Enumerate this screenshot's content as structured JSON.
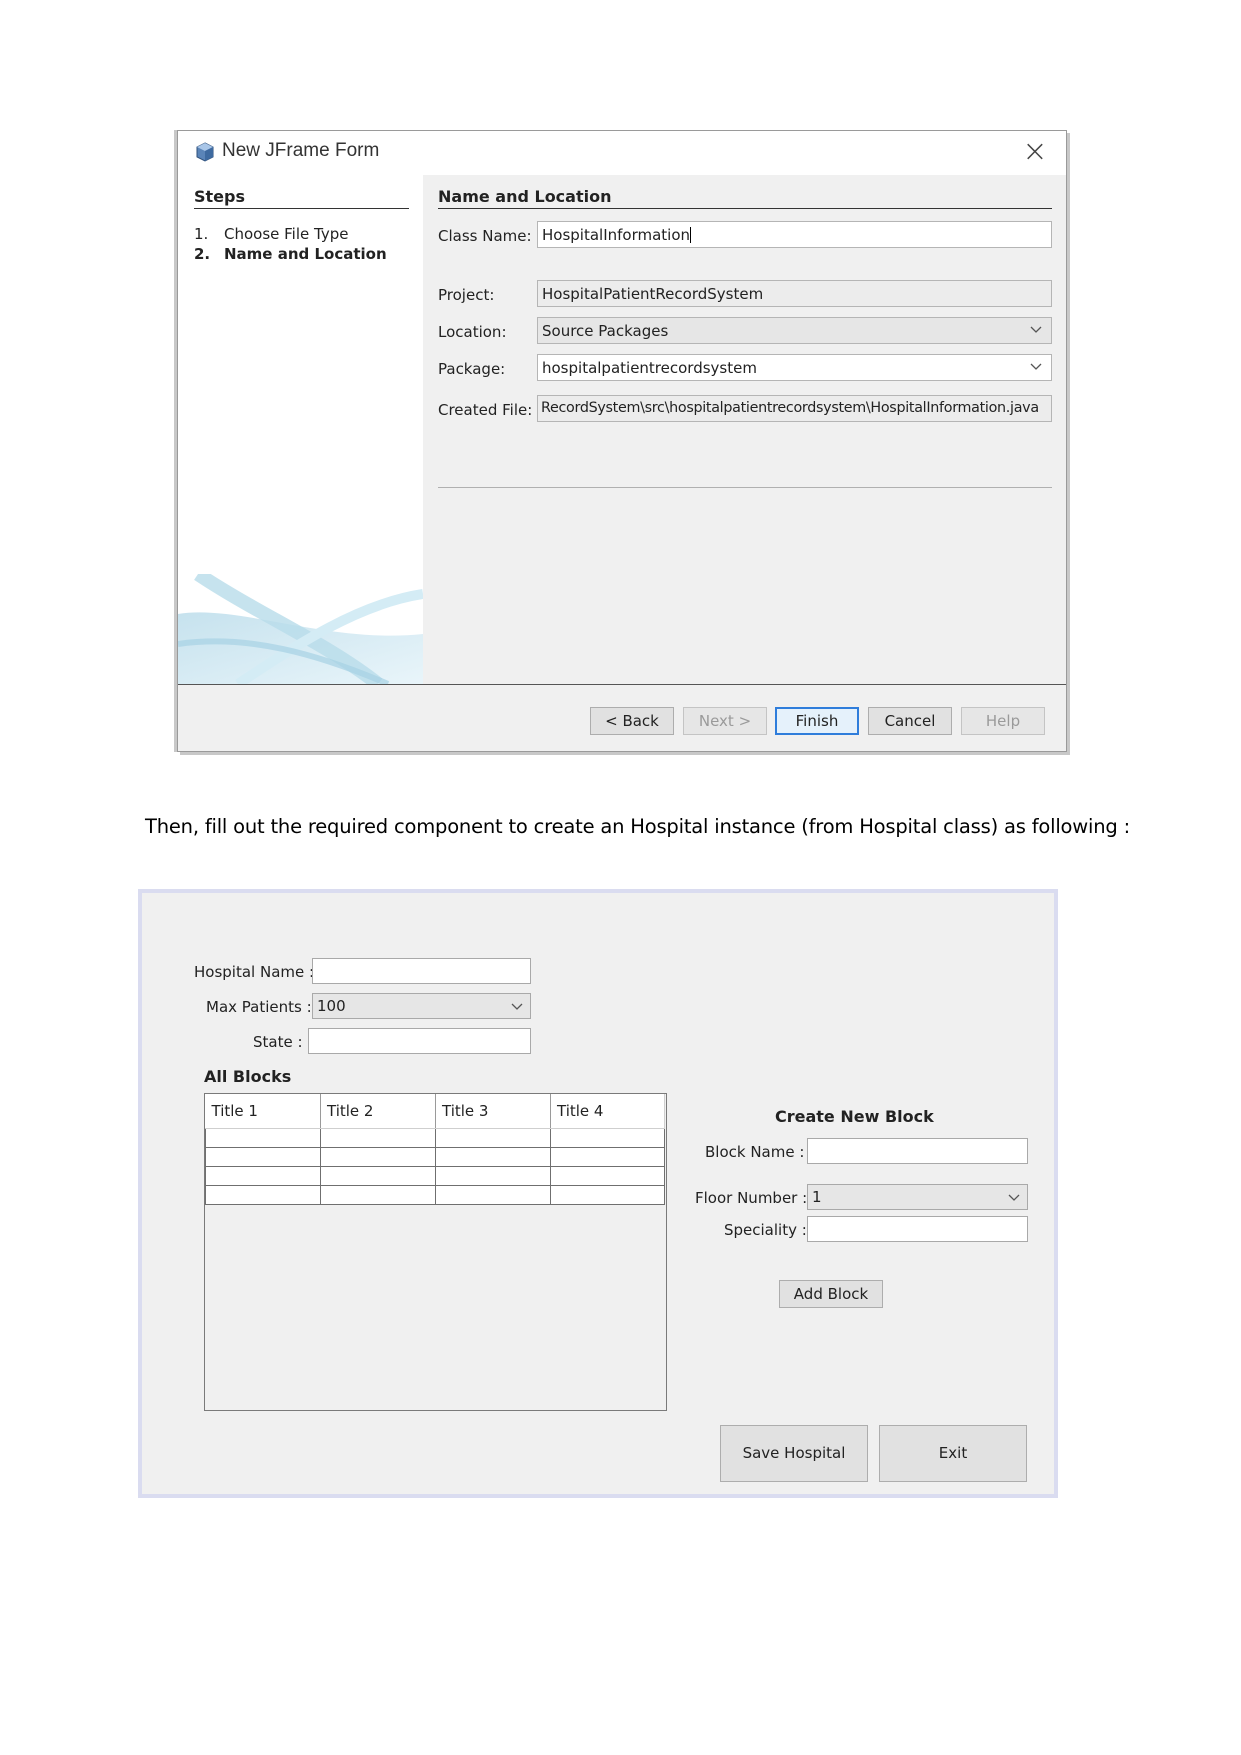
{
  "dialog": {
    "title": "New JFrame Form",
    "close_glyph": "×",
    "steps_heading": "Steps",
    "steps": [
      {
        "num": "1.",
        "label": "Choose File Type"
      },
      {
        "num": "2.",
        "label": "Name and Location"
      }
    ],
    "section_heading": "Name and Location",
    "class_name_label": "Class Name:",
    "class_name_value": "HospitalInformation",
    "project_label": "Project:",
    "project_value": "HospitalPatientRecordSystem",
    "location_label": "Location:",
    "location_value": "Source Packages",
    "package_label": "Package:",
    "package_value": "hospitalpatientrecordsystem",
    "created_file_label": "Created File:",
    "created_file_value": "RecordSystem\\src\\hospitalpatientrecordsystem\\HospitalInformation.java",
    "buttons": {
      "back": "< Back",
      "next": "Next >",
      "finish": "Finish",
      "cancel": "Cancel",
      "help": "Help"
    }
  },
  "paragraph": "Then, fill out  the required component to create an Hospital instance (from Hospital class) as following :",
  "hospital_form": {
    "hospital_name_label": "Hospital Name :",
    "max_patients_label": "Max Patients :",
    "max_patients_value": "100",
    "state_label": "State :",
    "all_blocks_title": "All Blocks",
    "table_headers": [
      "Title 1",
      "Title 2",
      "Title 3",
      "Title 4"
    ],
    "create_block_title": "Create New Block",
    "block_name_label": "Block Name :",
    "floor_number_label": "Floor Number :",
    "floor_number_value": "1",
    "speciality_label": "Speciality :",
    "add_block_button": "Add Block",
    "save_button": "Save Hospital",
    "exit_button": "Exit"
  }
}
